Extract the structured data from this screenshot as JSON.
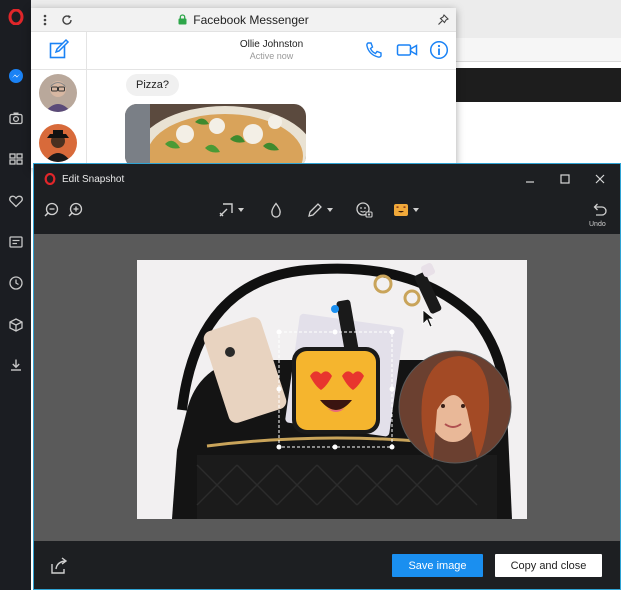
{
  "messenger": {
    "title": "Facebook Messenger",
    "contact_name": "Ollie Johnston",
    "contact_status": "Active now",
    "message": "Pizza?"
  },
  "snapshot": {
    "title": "Edit Snapshot",
    "undo_label": "Undo",
    "save_label": "Save image",
    "copy_label": "Copy and close"
  },
  "sidebar": {
    "items": [
      "opera-logo",
      "messenger-icon",
      "camera-icon",
      "grid-icon",
      "heart-icon",
      "news-icon",
      "history-icon",
      "cube-icon",
      "download-icon"
    ]
  },
  "colors": {
    "accent_blue": "#1a8ff0",
    "messenger_blue": "#1a82f5",
    "window_border": "#2fa3d4",
    "sidebar_bg": "#1b1d22",
    "opera_red": "#e0262a"
  }
}
